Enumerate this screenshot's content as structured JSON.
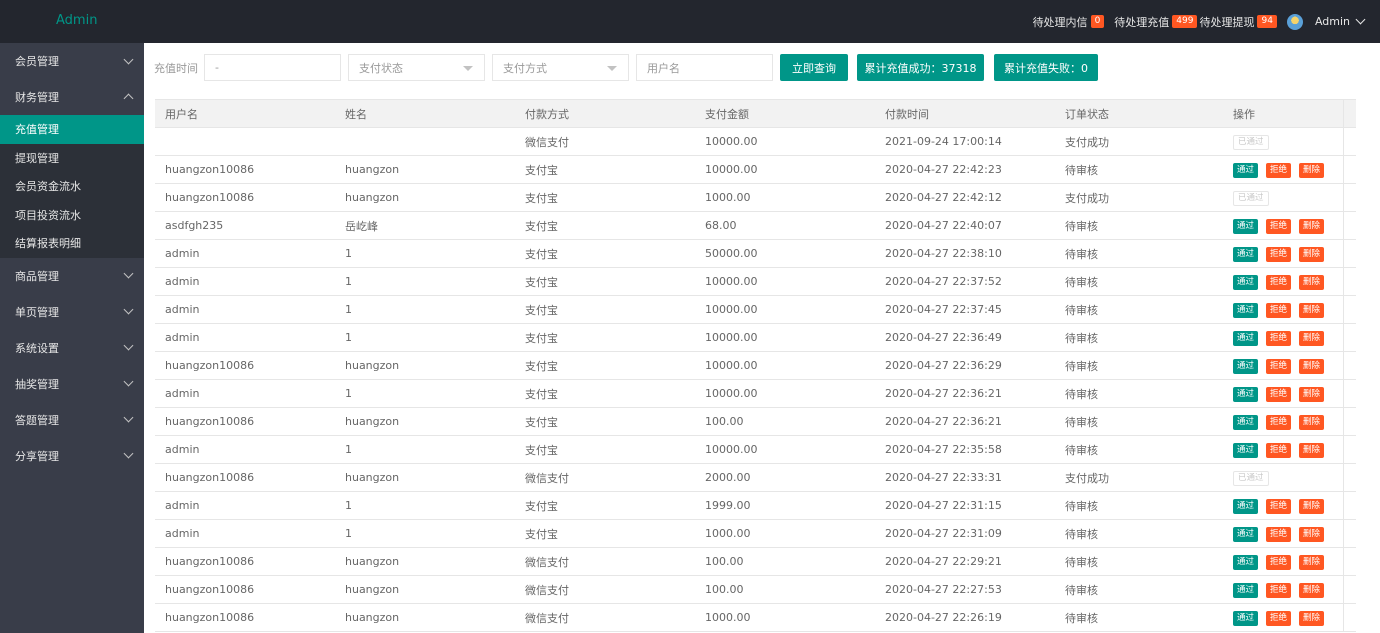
{
  "app": {
    "logo": "Admin"
  },
  "header": {
    "notices": [
      {
        "label": "待处理内信",
        "count": "0"
      },
      {
        "label": "待处理充值",
        "count": "499"
      },
      {
        "label": "待处理提现",
        "count": "94"
      }
    ],
    "user": "Admin"
  },
  "sidebar": {
    "groups": [
      {
        "label": "会员管理",
        "expanded": false
      },
      {
        "label": "财务管理",
        "expanded": true,
        "children": [
          "充值管理",
          "提现管理",
          "会员资金流水",
          "项目投资流水",
          "结算报表明细"
        ]
      },
      {
        "label": "商品管理",
        "expanded": false
      },
      {
        "label": "单页管理",
        "expanded": false
      },
      {
        "label": "系统设置",
        "expanded": false
      },
      {
        "label": "抽奖管理",
        "expanded": false
      },
      {
        "label": "答题管理",
        "expanded": false
      },
      {
        "label": "分享管理",
        "expanded": false
      }
    ],
    "active": "充值管理"
  },
  "filters": {
    "time_label": "充值时间",
    "time_value": "-",
    "status_placeholder": "支付状态",
    "method_placeholder": "支付方式",
    "username_placeholder": "用户名",
    "search_button": "立即查询",
    "total_success": "累计充值成功：37318",
    "total_fail": "累计充值失败：0"
  },
  "colors": {
    "accent": "#009688",
    "danger": "#ff5722",
    "topbar": "#23262e",
    "sidebar": "#393d49"
  },
  "table": {
    "columns": [
      "用户名",
      "姓名",
      "付款方式",
      "支付金额",
      "付款时间",
      "订单状态",
      "操作"
    ],
    "actions": {
      "pass": "通过",
      "reject": "拒绝",
      "delete": "删除",
      "done": "已通过"
    },
    "rows": [
      {
        "user": "",
        "name": "",
        "method": "微信支付",
        "amount": "10000.00",
        "time": "2021-09-24 17:00:14",
        "status": "支付成功",
        "done": true
      },
      {
        "user": "huangzon10086",
        "name": "huangzon",
        "method": "支付宝",
        "amount": "10000.00",
        "time": "2020-04-27 22:42:23",
        "status": "待审核",
        "done": false
      },
      {
        "user": "huangzon10086",
        "name": "huangzon",
        "method": "支付宝",
        "amount": "1000.00",
        "time": "2020-04-27 22:42:12",
        "status": "支付成功",
        "done": true
      },
      {
        "user": "asdfgh235",
        "name": "岳屹峰",
        "method": "支付宝",
        "amount": "68.00",
        "time": "2020-04-27 22:40:07",
        "status": "待审核",
        "done": false
      },
      {
        "user": "admin",
        "name": "1",
        "method": "支付宝",
        "amount": "50000.00",
        "time": "2020-04-27 22:38:10",
        "status": "待审核",
        "done": false
      },
      {
        "user": "admin",
        "name": "1",
        "method": "支付宝",
        "amount": "10000.00",
        "time": "2020-04-27 22:37:52",
        "status": "待审核",
        "done": false
      },
      {
        "user": "admin",
        "name": "1",
        "method": "支付宝",
        "amount": "10000.00",
        "time": "2020-04-27 22:37:45",
        "status": "待审核",
        "done": false
      },
      {
        "user": "admin",
        "name": "1",
        "method": "支付宝",
        "amount": "10000.00",
        "time": "2020-04-27 22:36:49",
        "status": "待审核",
        "done": false
      },
      {
        "user": "huangzon10086",
        "name": "huangzon",
        "method": "支付宝",
        "amount": "10000.00",
        "time": "2020-04-27 22:36:29",
        "status": "待审核",
        "done": false
      },
      {
        "user": "admin",
        "name": "1",
        "method": "支付宝",
        "amount": "10000.00",
        "time": "2020-04-27 22:36:21",
        "status": "待审核",
        "done": false
      },
      {
        "user": "huangzon10086",
        "name": "huangzon",
        "method": "支付宝",
        "amount": "100.00",
        "time": "2020-04-27 22:36:21",
        "status": "待审核",
        "done": false
      },
      {
        "user": "admin",
        "name": "1",
        "method": "支付宝",
        "amount": "10000.00",
        "time": "2020-04-27 22:35:58",
        "status": "待审核",
        "done": false
      },
      {
        "user": "huangzon10086",
        "name": "huangzon",
        "method": "微信支付",
        "amount": "2000.00",
        "time": "2020-04-27 22:33:31",
        "status": "支付成功",
        "done": true
      },
      {
        "user": "admin",
        "name": "1",
        "method": "支付宝",
        "amount": "1999.00",
        "time": "2020-04-27 22:31:15",
        "status": "待审核",
        "done": false
      },
      {
        "user": "admin",
        "name": "1",
        "method": "支付宝",
        "amount": "1000.00",
        "time": "2020-04-27 22:31:09",
        "status": "待审核",
        "done": false
      },
      {
        "user": "huangzon10086",
        "name": "huangzon",
        "method": "微信支付",
        "amount": "100.00",
        "time": "2020-04-27 22:29:21",
        "status": "待审核",
        "done": false
      },
      {
        "user": "huangzon10086",
        "name": "huangzon",
        "method": "微信支付",
        "amount": "100.00",
        "time": "2020-04-27 22:27:53",
        "status": "待审核",
        "done": false
      },
      {
        "user": "huangzon10086",
        "name": "huangzon",
        "method": "微信支付",
        "amount": "1000.00",
        "time": "2020-04-27 22:26:19",
        "status": "待审核",
        "done": false
      }
    ]
  }
}
